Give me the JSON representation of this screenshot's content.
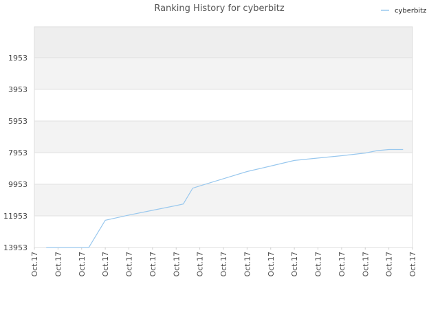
{
  "chart_data": {
    "type": "line",
    "title": "Ranking History for cyberbitz",
    "xlabel": "",
    "ylabel": "",
    "legend_position": "top-right",
    "y_inverted": true,
    "ylim": [
      13953,
      0
    ],
    "yticks": [
      1953,
      3953,
      5953,
      7953,
      9953,
      11953,
      13953
    ],
    "xtick_labels": [
      "Oct.17",
      "Oct.17",
      "Oct.17",
      "Oct.17",
      "Oct.17",
      "Oct.17",
      "Oct.17",
      "Oct.17",
      "Oct.17",
      "Oct.17",
      "Oct.17",
      "Oct.17",
      "Oct.17",
      "Oct.17",
      "Oct.17",
      "Oct.17",
      "Oct.17"
    ],
    "line_color": "#99c8ee",
    "band_colors": [
      "#eeeeee",
      "#f3f3f3",
      "#ffffff"
    ],
    "series": [
      {
        "name": "cyberbitz",
        "points": [
          [
            0.5,
            13953
          ],
          [
            1.0,
            13953
          ],
          [
            2.0,
            13953
          ],
          [
            2.3,
            13953
          ],
          [
            3.0,
            12230
          ],
          [
            4.0,
            11900
          ],
          [
            5.0,
            11600
          ],
          [
            6.0,
            11300
          ],
          [
            6.3,
            11200
          ],
          [
            6.7,
            10200
          ],
          [
            7.0,
            10060
          ],
          [
            8.0,
            9600
          ],
          [
            9.0,
            9150
          ],
          [
            10.0,
            8800
          ],
          [
            11.0,
            8450
          ],
          [
            12.0,
            8300
          ],
          [
            13.0,
            8150
          ],
          [
            14.0,
            7980
          ],
          [
            14.5,
            7830
          ],
          [
            15.0,
            7760
          ],
          [
            15.6,
            7760
          ]
        ]
      }
    ]
  }
}
